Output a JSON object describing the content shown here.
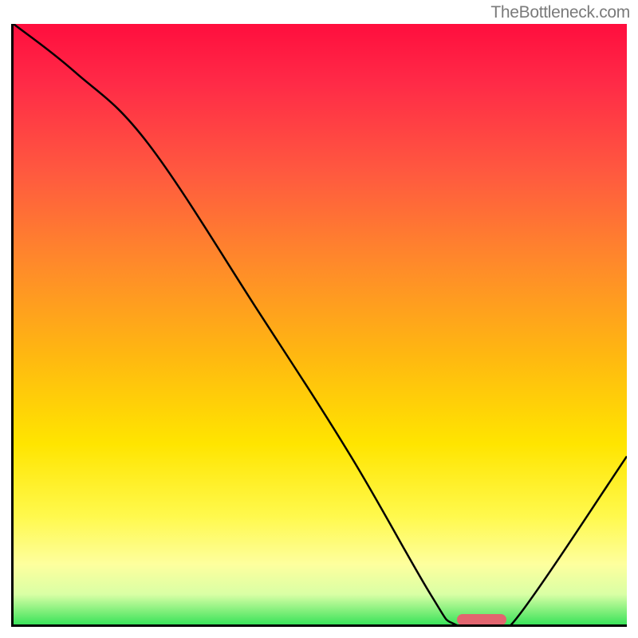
{
  "watermark": "TheBottleneck.com",
  "chart_data": {
    "type": "line",
    "title": "",
    "xlabel": "",
    "ylabel": "",
    "xlim": [
      0,
      100
    ],
    "ylim": [
      0,
      100
    ],
    "x": [
      0,
      10,
      22,
      40,
      55,
      68,
      72,
      78,
      82,
      100
    ],
    "values": [
      100,
      92,
      80,
      52,
      28,
      5,
      0,
      0,
      1,
      28
    ],
    "background_gradient": {
      "stops": [
        {
          "pos": 0,
          "color": "#ff0e3e"
        },
        {
          "pos": 10,
          "color": "#ff2b47"
        },
        {
          "pos": 25,
          "color": "#ff5a3f"
        },
        {
          "pos": 40,
          "color": "#ff8a2a"
        },
        {
          "pos": 55,
          "color": "#ffb711"
        },
        {
          "pos": 70,
          "color": "#ffe500"
        },
        {
          "pos": 82,
          "color": "#fff94d"
        },
        {
          "pos": 90,
          "color": "#feff9e"
        },
        {
          "pos": 95,
          "color": "#d9ffa5"
        },
        {
          "pos": 100,
          "color": "#3be35a"
        }
      ]
    },
    "marker": {
      "x_start": 72,
      "x_end": 80,
      "y": 0,
      "color": "#e2656f"
    }
  }
}
